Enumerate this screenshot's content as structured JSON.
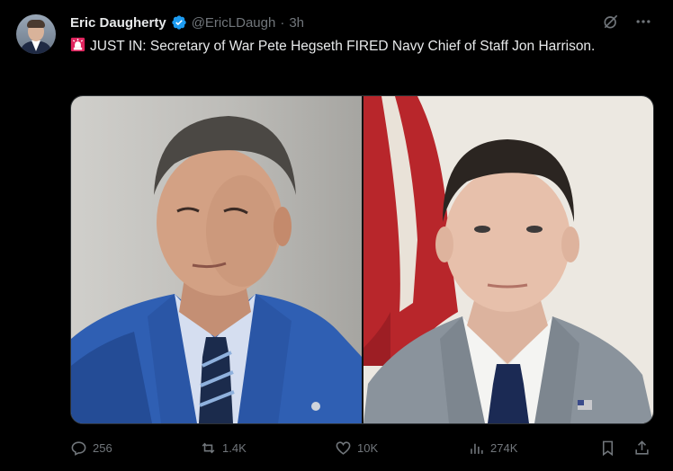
{
  "tweet": {
    "author_name": "Eric Daugherty",
    "handle": "@EricLDaugh",
    "separator": "·",
    "time": "3h",
    "text": "JUST IN: Secretary of War Pete Hegseth FIRED Navy Chief of Staff Jon Harrison.",
    "emoji": "rotating-light-icon"
  },
  "stats": {
    "replies": "256",
    "reposts": "1.4K",
    "likes": "10K",
    "views": "274K"
  },
  "colors": {
    "background": "#000000",
    "text": "#e7e9ea",
    "muted": "#71767b",
    "verified": "#1d9bf0",
    "border": "#2f3336"
  }
}
